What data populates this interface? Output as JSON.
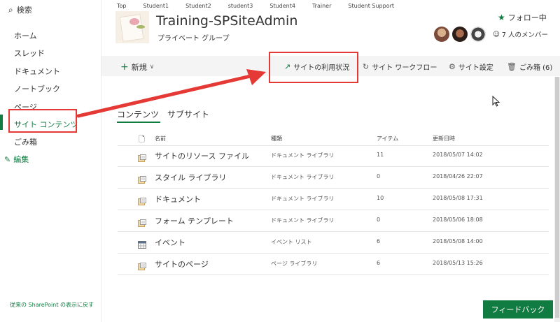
{
  "sidebar": {
    "search_label": "検索",
    "items": [
      {
        "label": "ホーム"
      },
      {
        "label": "スレッド"
      },
      {
        "label": "ドキュメント"
      },
      {
        "label": "ノートブック"
      },
      {
        "label": "ページ"
      },
      {
        "label": "サイト コンテンツ"
      },
      {
        "label": "ごみ箱"
      }
    ],
    "edit_label": "編集",
    "classic_link": "従来の SharePoint の表示に戻す"
  },
  "top_nav": [
    "Top",
    "Student1",
    "Student2",
    "student3",
    "Student4",
    "Trainer",
    "Student Support"
  ],
  "site": {
    "title": "Training-SPSiteAdmin",
    "subtitle": "プライベート グループ",
    "follow_label": "フォロー中",
    "members_label": "7 人のメンバー"
  },
  "commandbar": {
    "new_label": "新規",
    "usage_label": "サイトの利用状況",
    "workflow_label": "サイト ワークフロー",
    "settings_label": "サイト設定",
    "recycle_label": "ごみ箱 (6)"
  },
  "tabs": [
    {
      "label": "コンテンツ"
    },
    {
      "label": "サブサイト"
    }
  ],
  "table": {
    "headers": {
      "name": "名前",
      "type": "種類",
      "items": "アイテム",
      "modified": "更新日時"
    },
    "rows": [
      {
        "name": "サイトのリソース ファイル",
        "type": "ドキュメント ライブラリ",
        "items": "11",
        "modified": "2018/05/07 14:02",
        "icon": "library-icon"
      },
      {
        "name": "スタイル ライブラリ",
        "type": "ドキュメント ライブラリ",
        "items": "0",
        "modified": "2018/04/26 22:07",
        "icon": "library-icon"
      },
      {
        "name": "ドキュメント",
        "type": "ドキュメント ライブラリ",
        "items": "10",
        "modified": "2018/05/08 17:31",
        "icon": "library-icon"
      },
      {
        "name": "フォーム テンプレート",
        "type": "ドキュメント ライブラリ",
        "items": "0",
        "modified": "2018/05/06 18:08",
        "icon": "library-icon"
      },
      {
        "name": "イベント",
        "type": "イベント リスト",
        "items": "6",
        "modified": "2018/05/08 14:00",
        "icon": "calendar-icon"
      },
      {
        "name": "サイトのページ",
        "type": "ページ ライブラリ",
        "items": "6",
        "modified": "2018/05/13 15:26",
        "icon": "library-icon"
      }
    ]
  },
  "feedback_label": "フィードバック",
  "colors": {
    "accent": "#107c41",
    "annotation": "#e53935"
  }
}
